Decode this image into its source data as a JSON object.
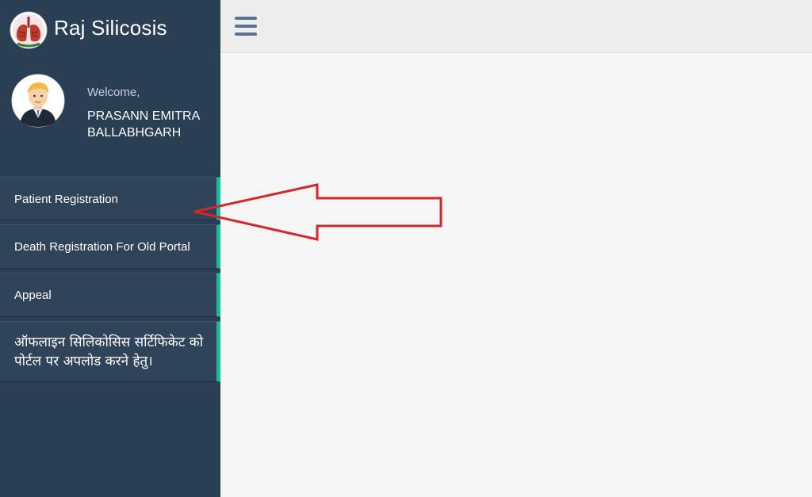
{
  "app": {
    "title": "Raj Silicosis"
  },
  "profile": {
    "welcome": "Welcome,",
    "name": "PRASANN EMITRA BALLABHGARH"
  },
  "sidebar": {
    "items": [
      {
        "label": "Patient Registration"
      },
      {
        "label": "Death Registration For Old Portal"
      },
      {
        "label": "Appeal"
      },
      {
        "label": "ऑफलाइन सिलिकोसिस सर्टिफिकेट को पोर्टल पर अपलोड करने हेतु।"
      }
    ]
  },
  "icons": {
    "menu_toggle": "hamburger-icon",
    "logo": "lungs-logo",
    "avatar": "user-avatar",
    "annotation": "arrow-pointer"
  },
  "colors": {
    "sidebar": "#2a3f54",
    "menu_item": "#2f4359",
    "accent": "#1abb9c",
    "topbar": "#ededed",
    "arrow": "#d3272e"
  }
}
